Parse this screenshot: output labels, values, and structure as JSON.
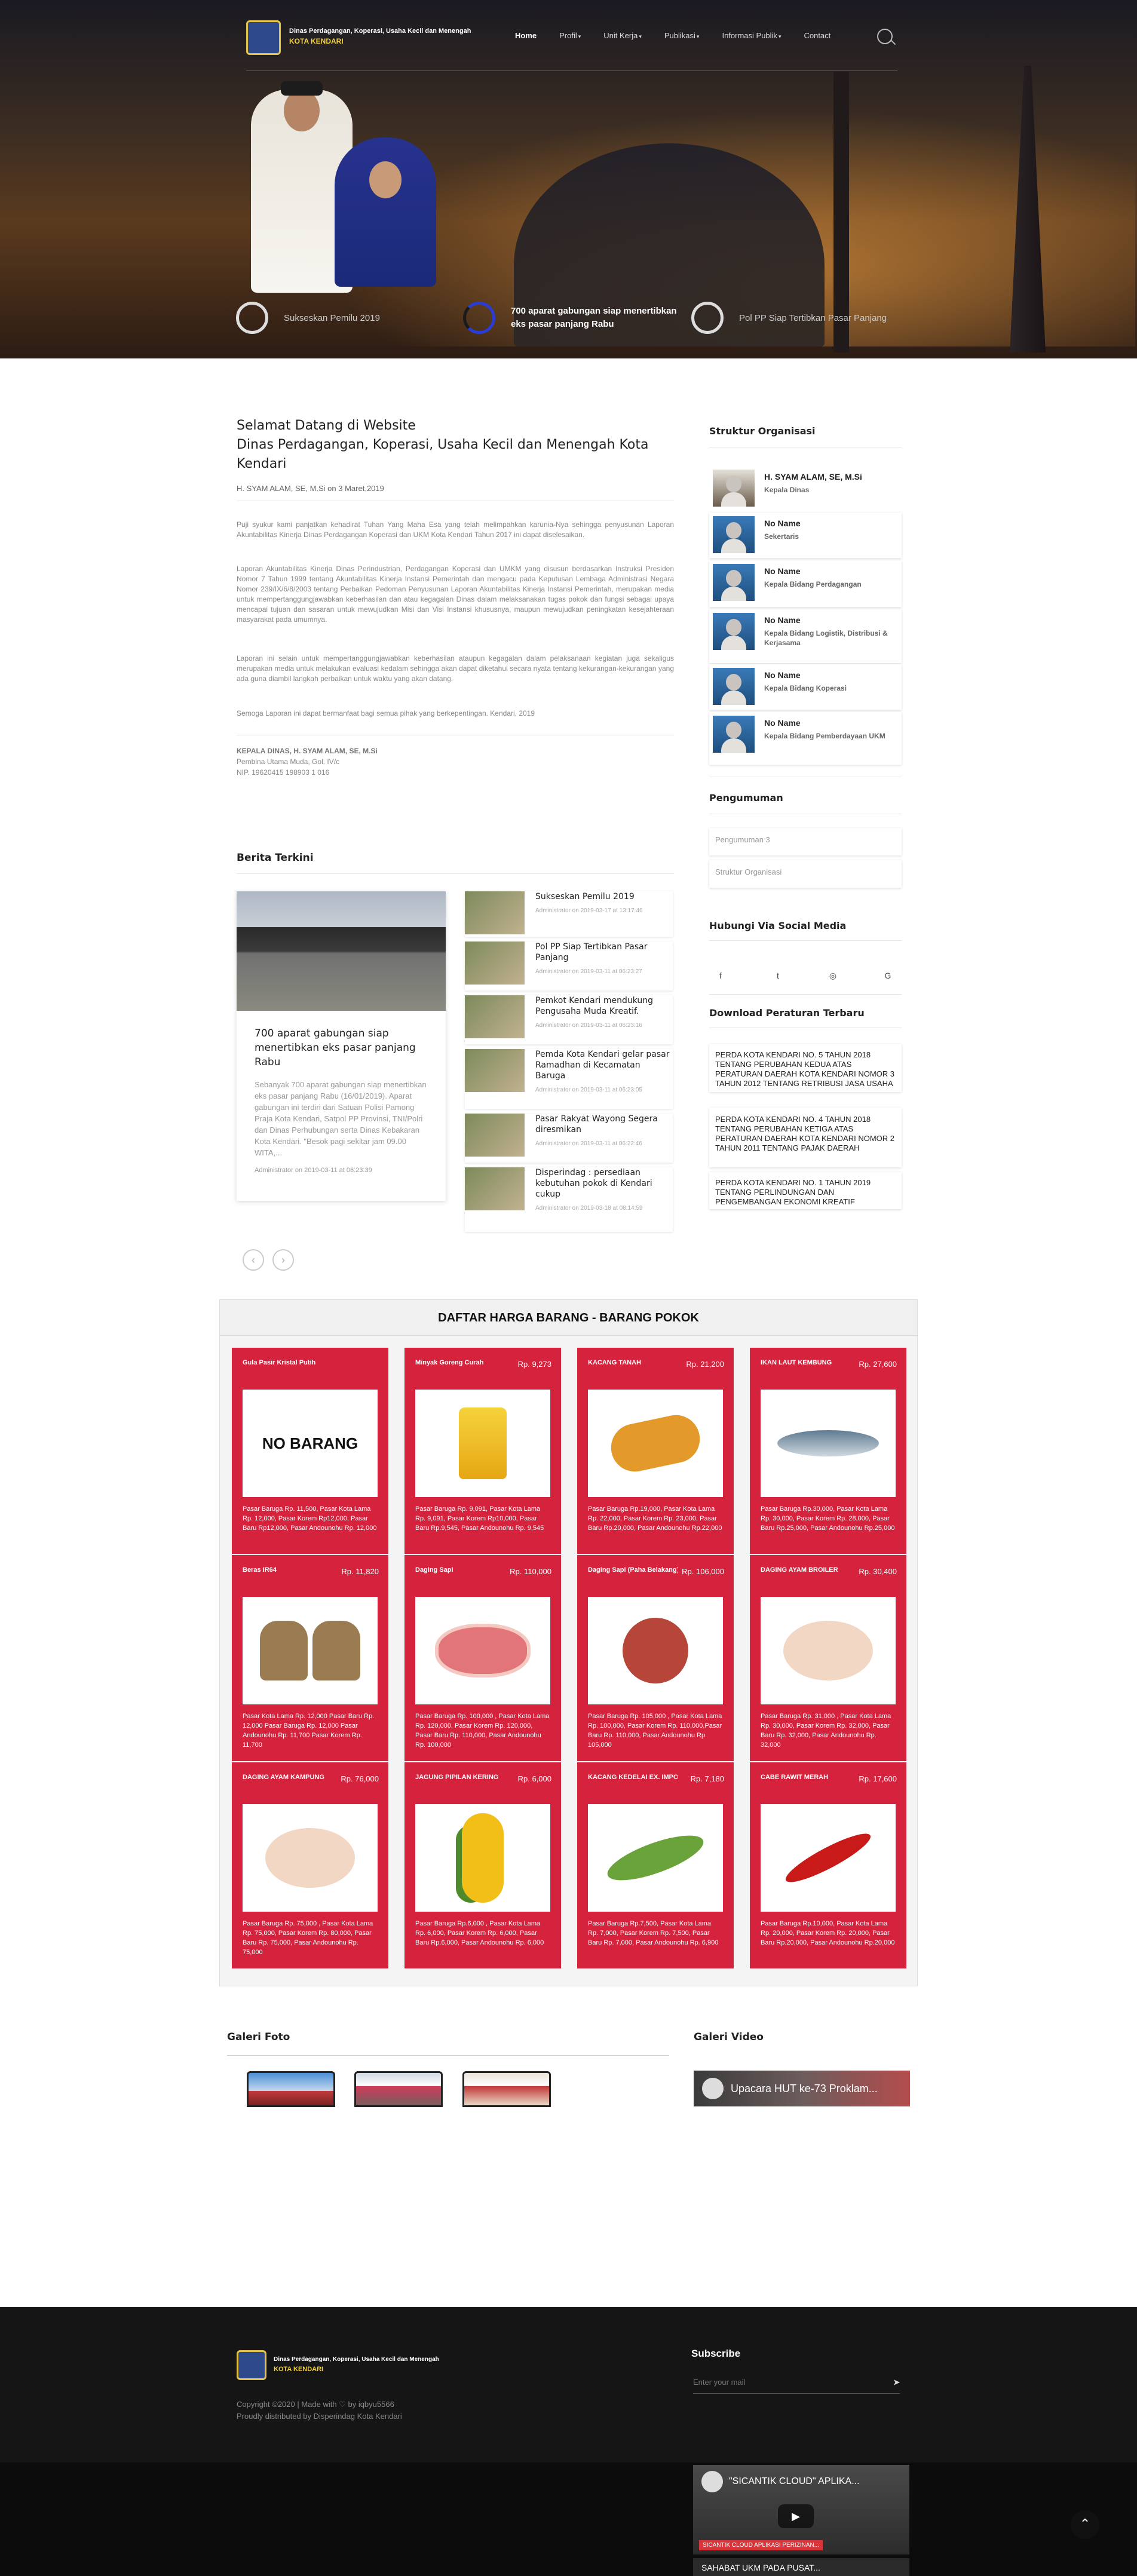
{
  "header": {
    "org_line1": "Dinas Perdagangan, Koperasi, Usaha Kecil dan Menengah",
    "org_line2": "KOTA KENDARI",
    "menu": [
      {
        "label": "Home"
      },
      {
        "label": "Profil"
      },
      {
        "label": "Unit Kerja"
      },
      {
        "label": "Publikasi"
      },
      {
        "label": "Informasi Publik"
      },
      {
        "label": "Contact"
      }
    ],
    "caret": "▾"
  },
  "slider": [
    {
      "label": "Sukseskan Pemilu 2019",
      "active": false
    },
    {
      "label": "700 aparat gabungan siap menertibkan eks pasar panjang Rabu",
      "active": true
    },
    {
      "label": "Pol PP Siap Tertibkan Pasar Panjang",
      "active": false
    }
  ],
  "welcome": {
    "title_line1": "Selamat Datang di Website",
    "title_line2": "Dinas Perdagangan, Koperasi, Usaha Kecil dan Menengah Kota Kendari",
    "meta": "H. SYAM ALAM, SE, M.Si on 3 Maret,2019",
    "p1": "Puji syukur kami panjatkan kehadirat Tuhan Yang Maha Esa yang telah melimpahkan karunia-Nya sehingga penyusunan Laporan Akuntabilitas Kinerja Dinas Perdagangan Koperasi dan UKM Kota Kendari Tahun 2017 ini dapat diselesaikan.",
    "p2": "Laporan Akuntabilitas Kinerja Dinas Perindustrian, Perdagangan Koperasi dan UMKM yang disusun berdasarkan Instruksi Presiden Nomor 7 Tahun 1999 tentang Akuntabilitas Kinerja Instansi Pemerintah dan mengacu pada Keputusan Lembaga Administrasi Negara Nomor 239/IX/6/8/2003 tentang Perbaikan Pedoman Penyusunan Laporan Akuntabilitas Kinerja Instansi Pemerintah, merupakan media untuk mempertanggungjawabkan keberhasilan dan atau kegagalan Dinas dalam melaksanakan tugas pokok dan fungsi sebagai upaya mencapai tujuan dan sasaran untuk mewujudkan Misi dan Visi Instansi khususnya, maupun mewujudkan peningkatan kesejahteraan masyarakat pada umumnya.",
    "p3": "Laporan ini selain untuk mempertanggungjawabkan keberhasilan ataupun kegagalan dalam pelaksanaan kegiatan juga sekaligus merupakan media untuk melakukan evaluasi kedalam sehingga akan dapat diketahui secara nyata tentang kekurangan-kekurangan yang ada guna diambil langkah perbaikan untuk waktu yang akan datang.",
    "p4": "Semoga Laporan ini dapat bermanfaat bagi semua pihak yang berkepentingan. Kendari, 2019",
    "sign_title": "KEPALA DINAS, H. SYAM ALAM, SE, M.Si",
    "sign_rank": "Pembina Utama Muda, Gol. IV/c",
    "sign_nip": "NIP. 19620415 198903 1 016"
  },
  "news": {
    "heading": "Berita Terkini",
    "featured": {
      "title": "700 aparat gabungan siap menertibkan eks pasar panjang Rabu",
      "excerpt": "Sebanyak 700 aparat gabungan siap menertibkan eks pasar panjang Rabu (16/01/2019). Aparat gabungan ini terdiri dari Satuan Polisi Pamong Praja Kota Kendari, Satpol PP Provinsi, TNI/Polri dan Dinas Perhubungan serta Dinas Kebakaran Kota Kendari. \"Besok pagi sekitar jam 09.00 WITA,...",
      "byline": "Administrator on 2019-03-11 at 06:23:39"
    },
    "items": [
      {
        "title": "Sukseskan Pemilu 2019",
        "byline": "Administrator on 2019-03-17 at 13:17:46"
      },
      {
        "title": "Pol PP Siap Tertibkan Pasar Panjang",
        "byline": "Administrator on 2019-03-11 at 06:23:27"
      },
      {
        "title": "Pemkot Kendari mendukung Pengusaha Muda Kreatif.",
        "byline": "Administrator on 2019-03-11 at 06:23:16"
      },
      {
        "title": "Pemda Kota Kendari gelar pasar Ramadhan di Kecamatan Baruga",
        "byline": "Administrator on 2019-03-11 at 06:23:05"
      },
      {
        "title": "Pasar Rakyat Wayong Segera diresmikan",
        "byline": "Administrator on 2019-03-11 at 06:22:46"
      },
      {
        "title": "Disperindag : persediaan kebutuhan pokok di Kendari cukup",
        "byline": "Administrator on 2019-03-18 at 08:14:59"
      }
    ],
    "prev": "‹",
    "next": "›"
  },
  "sidebar": {
    "struktur_heading": "Struktur Organisasi",
    "struktur": [
      {
        "name": "H. SYAM ALAM, SE, M.Si",
        "role": "Kepala Dinas"
      },
      {
        "name": "No Name",
        "role": "Sekertaris"
      },
      {
        "name": "No Name",
        "role": "Kepala Bidang Perdagangan"
      },
      {
        "name": "No Name",
        "role": "Kepala Bidang Logistik, Distribusi & Kerjasama"
      },
      {
        "name": "No Name",
        "role": "Kepala Bidang Koperasi"
      },
      {
        "name": "No Name",
        "role": "Kepala Bidang Pemberdayaan UKM"
      }
    ],
    "pengumuman_heading": "Pengumuman",
    "pengumuman": [
      "Pengumuman 3",
      "Struktur Organisasi"
    ],
    "social_heading": "Hubungi Via Social Media",
    "social": [
      {
        "icon": "facebook-icon",
        "glyph": "f"
      },
      {
        "icon": "twitter-icon",
        "glyph": "t"
      },
      {
        "icon": "instagram-icon",
        "glyph": "◎"
      },
      {
        "icon": "google-icon",
        "glyph": "G"
      }
    ],
    "peraturan_heading": "Download Peraturan Terbaru",
    "peraturan": [
      "PERDA KOTA KENDARI NO. 5 TAHUN 2018 TENTANG PERUBAHAN KEDUA ATAS PERATURAN DAERAH KOTA KENDARI NOMOR 3 TAHUN 2012 TENTANG RETRIBUSI JASA USAHA",
      "PERDA KOTA KENDARI NO. 4 TAHUN 2018 TENTANG PERUBAHAN KETIGA ATAS PERATURAN DAERAH KOTA KENDARI NOMOR 2 TAHUN 2011 TENTANG PAJAK DAERAH",
      "PERDA KOTA KENDARI NO. 1 TAHUN 2019 TENTANG PERLINDUNGAN DAN PENGEMBANGAN EKONOMI KREATIF"
    ]
  },
  "harga": {
    "heading": "DAFTAR HARGA BARANG - BARANG POKOK",
    "items": [
      {
        "name": "Gula Pasir Kristal Putih",
        "price": "",
        "img": "NO BARANG",
        "desc": "Pasar Baruga Rp. 11,500, Pasar Kota Lama Rp. 12,000, Pasar Korem Rp12,000, Pasar Baru Rp12,000, Pasar Andounohu Rp. 12,000"
      },
      {
        "name": "Minyak Goreng Curah",
        "price": "Rp. 9,273",
        "img": "oil",
        "desc": "Pasar Baruga Rp. 9,091, Pasar Kota Lama Rp. 9,091, Pasar Korem Rp10,000, Pasar Baru Rp.9,545, Pasar Andounohu Rp. 9,545"
      },
      {
        "name": "KACANG TANAH",
        "price": "Rp. 21,200",
        "img": "peanut",
        "desc": "Pasar Baruga Rp.19,000, Pasar Kota Lama Rp. 22,000, Pasar Korem Rp. 23,000, Pasar Baru Rp.20,000, Pasar Andounohu Rp.22,000"
      },
      {
        "name": "IKAN LAUT KEMBUNG",
        "price": "Rp. 27,600",
        "img": "fish",
        "desc": "Pasar Baruga Rp.30,000, Pasar Kota Lama Rp. 30,000, Pasar Korem Rp. 28,000, Pasar Baru Rp.25,000, Pasar Andounohu Rp.25,000"
      },
      {
        "name": "Beras IR64",
        "price": "Rp. 11,820",
        "img": "rice",
        "desc": "Pasar Kota Lama Rp. 12,000 Pasar Baru Rp. 12,000 Pasar Baruga Rp. 12,000 Pasar Andounohu Rp. 11,700 Pasar Korem Rp. 11,700"
      },
      {
        "name": "Daging Sapi",
        "price": "Rp. 110,000",
        "img": "beef",
        "desc": "Pasar Baruga Rp. 100,000 , Pasar Kota Lama Rp. 120,000, Pasar Korem Rp. 120,000, Pasar Baru Rp. 110,000, Pasar Andounohu Rp. 100,000"
      },
      {
        "name": "Daging Sapi (Paha Belakang)",
        "price": "Rp. 106,000",
        "img": "ham",
        "desc": "Pasar Baruga Rp. 105,000 , Pasar Kota Lama Rp. 100,000, Pasar Korem Rp. 110,000,Pasar Baru Rp. 110,000, Pasar Andounohu Rp. 105,000"
      },
      {
        "name": "DAGING AYAM BROILER",
        "price": "Rp. 30,400",
        "img": "chicken",
        "desc": "Pasar Baruga Rp. 31,000 , Pasar Kota Lama Rp. 30,000, Pasar Korem Rp. 32,000, Pasar Baru Rp. 32,000, Pasar Andounohu Rp. 32,000"
      },
      {
        "name": "DAGING AYAM KAMPUNG",
        "price": "Rp. 76,000",
        "img": "chicken",
        "desc": "Pasar Baruga Rp. 75,000 , Pasar Kota Lama Rp. 75,000, Pasar Korem Rp. 80,000, Pasar Baru Rp. 75,000, Pasar Andounohu Rp. 75,000"
      },
      {
        "name": "JAGUNG PIPILAN KERING",
        "price": "Rp. 6,000",
        "img": "corn",
        "desc": "Pasar Baruga Rp.6,000 , Pasar Kota Lama Rp. 6,000, Pasar Korem Rp. 6,000, Pasar Baru Rp.6,000, Pasar Andounohu Rp. 6,000"
      },
      {
        "name": "KACANG KEDELAI EX. IMPOR",
        "price": "Rp. 7,180",
        "img": "pea",
        "desc": "Pasar Baruga Rp.7,500, Pasar Kota Lama Rp. 7,000, Pasar Korem Rp. 7,500, Pasar Baru Rp. 7,000, Pasar Andounohu Rp. 6,900"
      },
      {
        "name": "CABE RAWIT MERAH",
        "price": "Rp. 17,600",
        "img": "chili",
        "desc": "Pasar Baruga Rp.10,000, Pasar Kota Lama Rp. 20,000, Pasar Korem Rp. 20,000, Pasar Baru Rp.20,000, Pasar Andounohu Rp.20,000"
      }
    ]
  },
  "galeri": {
    "foto_heading": "Galeri Foto",
    "video_heading": "Galeri Video",
    "video_title": "Upacara HUT ke-73 Proklam..."
  },
  "footer": {
    "org_line1": "Dinas Perdagangan, Koperasi, Usaha Kecil dan Menengah",
    "org_line2": "KOTA KENDARI",
    "copyright": "Copyright ©2020 | Made with ♡ by iqbyu5566",
    "distributed": "Proudly distributed by Disperindag Kota Kendari",
    "subscribe_heading": "Subscribe",
    "subscribe_placeholder": "Enter your mail",
    "subscribe_arrow": "➤",
    "yt1_title": "\"SICANTIK CLOUD\" APLIKA...",
    "yt1_caption": "SICANTIK CLOUD APLIKASI PERIZINAN...",
    "yt2_title": "SAHABAT UKM PADA PUSAT...",
    "totop": "⌃"
  },
  "colors": {
    "accent": "#d6233d",
    "footer": "#151515",
    "slider_active": "#2a3cd4"
  }
}
